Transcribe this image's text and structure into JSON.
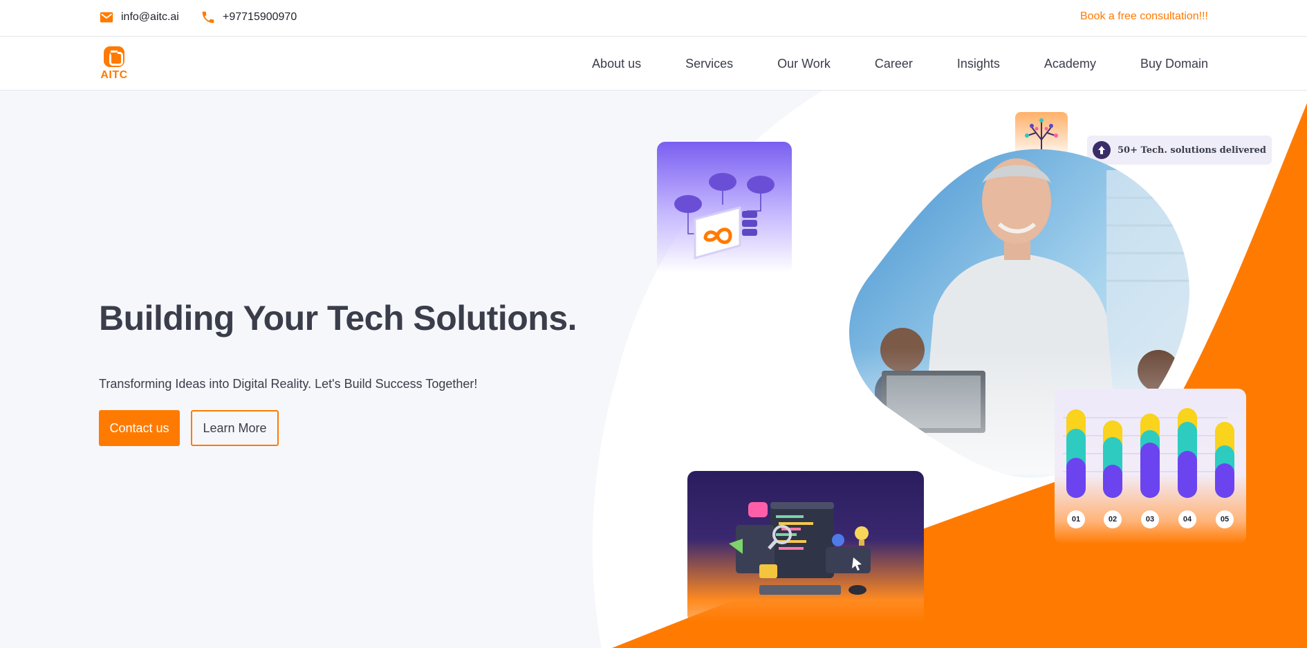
{
  "topbar": {
    "email": "info@aitc.ai",
    "phone": "+97715900970",
    "consult_link": "Book a free consultation!!!"
  },
  "brand": {
    "name": "AITC",
    "accent": "#ff7a00",
    "dark": "#3a3d4a"
  },
  "nav": {
    "items": [
      "About us",
      "Services",
      "Our Work",
      "Career",
      "Insights",
      "Academy",
      "Buy Domain"
    ]
  },
  "hero": {
    "title": "Building Your Tech Solutions.",
    "subtitle": "Transforming Ideas into Digital Reality. Let's Build Success Together!",
    "primary_button": "Contact us",
    "secondary_button": "Learn More",
    "stat_badge": "50+ Tech. solutions delivered",
    "stat_icon": "arrow-up-icon",
    "chart_labels": [
      "01",
      "02",
      "03",
      "04",
      "05"
    ]
  }
}
